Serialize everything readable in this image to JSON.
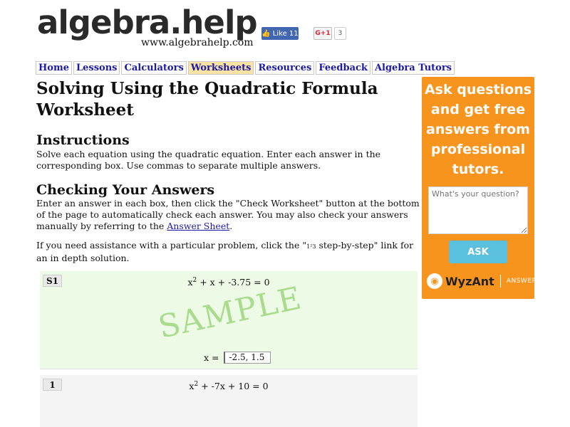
{
  "header": {
    "logo_text": "algebra.help",
    "subdomain": "www.algebrahelp.com",
    "fb_like_label": "Like 11",
    "gplus_label": "G+1",
    "gplus_count": "3"
  },
  "nav": {
    "items": [
      {
        "label": "Home"
      },
      {
        "label": "Lessons"
      },
      {
        "label": "Calculators"
      },
      {
        "label": "Worksheets"
      },
      {
        "label": "Resources"
      },
      {
        "label": "Feedback"
      },
      {
        "label": "Algebra Tutors"
      }
    ],
    "active": "Worksheets"
  },
  "main": {
    "title": "Solving Using the Quadratic Formula Worksheet",
    "instructions_heading": "Instructions",
    "instructions_text": "Solve each equation using the quadratic equation. Enter each answer in the corresponding box. Use commas to separate multiple answers.",
    "checking_heading": "Checking Your Answers",
    "checking_text": "Enter an answer in each box, then click the \"Check Worksheet\" button at the bottom of the page to automatically check each answer.  You may also check your answers manually by referring to the ",
    "answer_sheet_link": "Answer Sheet",
    "checking_text_end": ".",
    "help_text_1": " If you need assistance with a particular problem, click the \"",
    "help_icon": "1²3",
    "help_text_2": " step-by-step\" link for an in depth solution."
  },
  "problems": {
    "sample": {
      "number": "S1",
      "equation_pre": "x",
      "equation_exp": "2",
      "equation_post": " + x + -3.75 = 0",
      "watermark": "SAMPLE",
      "answer_label": "x =",
      "answer_value": "-2.5, 1.5"
    },
    "p1": {
      "number": "1",
      "equation_pre": "x",
      "equation_exp": "2",
      "equation_post": " + -7x + 10 = 0"
    }
  },
  "ad": {
    "headline": "Ask questions and get free answers from professional tutors.",
    "question_placeholder": "What's your question?",
    "ask_button": "ASK",
    "brand": "WyzAnt",
    "brand_suffix": "ANSWERS",
    "accent_color": "#f7941d",
    "button_color": "#5bc0de"
  }
}
